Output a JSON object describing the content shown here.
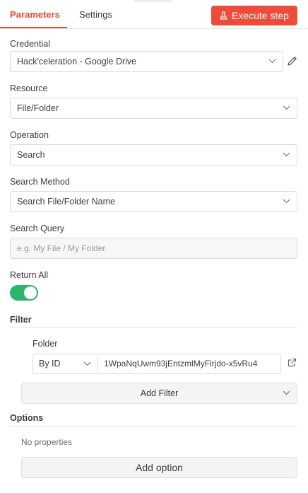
{
  "tabs": [
    {
      "label": "Parameters",
      "active": true
    },
    {
      "label": "Settings",
      "active": false
    }
  ],
  "execute_button": {
    "label": "Execute step",
    "icon": "flask-icon",
    "color": "#ef4b3b"
  },
  "credential": {
    "label": "Credential",
    "value": "Hack'celeration - Google Drive",
    "edit_icon": "pencil-icon"
  },
  "resource": {
    "label": "Resource",
    "value": "File/Folder"
  },
  "operation": {
    "label": "Operation",
    "value": "Search"
  },
  "search_method": {
    "label": "Search Method",
    "value": "Search File/Folder Name"
  },
  "search_query": {
    "label": "Search Query",
    "value": "",
    "placeholder": "e.g. My File / My Folder"
  },
  "return_all": {
    "label": "Return All",
    "enabled": true,
    "color": "#29b56b"
  },
  "filter": {
    "title": "Filter",
    "folder": {
      "label": "Folder",
      "mode": "By ID",
      "value": "1WpaNqUwm93jEntzmlMyFlrjdo-x5vRu4"
    },
    "add_filter_label": "Add Filter"
  },
  "options": {
    "title": "Options",
    "empty_text": "No properties",
    "add_option_label": "Add option"
  },
  "accent_color": "#ea4b36"
}
